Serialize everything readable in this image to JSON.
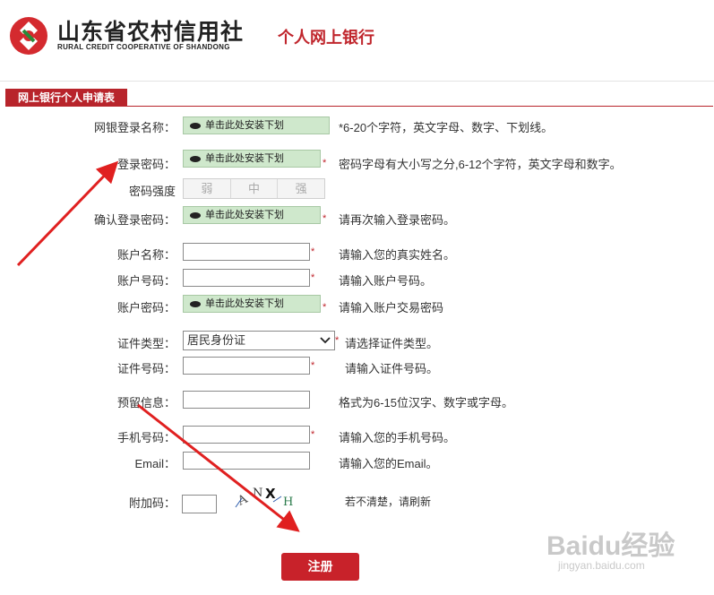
{
  "header": {
    "brand_cn": "山东省农村信用社",
    "brand_en": "RURAL CREDIT COOPERATIVE OF SHANDONG",
    "title": "个人网上银行"
  },
  "section": {
    "tab_label": "网上银行个人申请表"
  },
  "secure_input_text": "单击此处安装下划",
  "required_mark": "*",
  "form": {
    "login_name": {
      "label": "网银登录名称：",
      "hint": "*6-20个字符，英文字母、数字、下划线。"
    },
    "login_password": {
      "label": "登录密码：",
      "hint": "密码字母有大小写之分,6-12个字符，英文字母和数字。"
    },
    "strength": {
      "label": "密码强度",
      "levels": [
        "弱",
        "中",
        "强"
      ]
    },
    "confirm_password": {
      "label": "确认登录密码：",
      "hint": "请再次输入登录密码。"
    },
    "account_name": {
      "label": "账户名称：",
      "hint": "请输入您的真实姓名。"
    },
    "account_number": {
      "label": "账户号码：",
      "hint": "请输入账户号码。"
    },
    "account_password": {
      "label": "账户密码：",
      "hint": "请输入账户交易密码"
    },
    "id_type": {
      "label": "证件类型：",
      "value": "居民身份证",
      "hint": "请选择证件类型。"
    },
    "id_number": {
      "label": "证件号码：",
      "hint": "请输入证件号码。"
    },
    "reserved_info": {
      "label": "预留信息：",
      "hint": "格式为6-15位汉字、数字或字母。"
    },
    "phone": {
      "label": "手机号码：",
      "hint": "请输入您的手机号码。"
    },
    "email": {
      "label": "Email：",
      "hint": "请输入您的Email。"
    },
    "captcha": {
      "label": "附加码：",
      "image_text": "ANXH",
      "hint": "若不清楚，请刷新"
    }
  },
  "submit_label": "注册",
  "watermark": {
    "main": "Baidu经验",
    "sub": "jingyan.baidu.com"
  },
  "colors": {
    "brand_red": "#c0262d",
    "secure_green": "#cfe8cc",
    "arrow_red": "#e02020"
  }
}
